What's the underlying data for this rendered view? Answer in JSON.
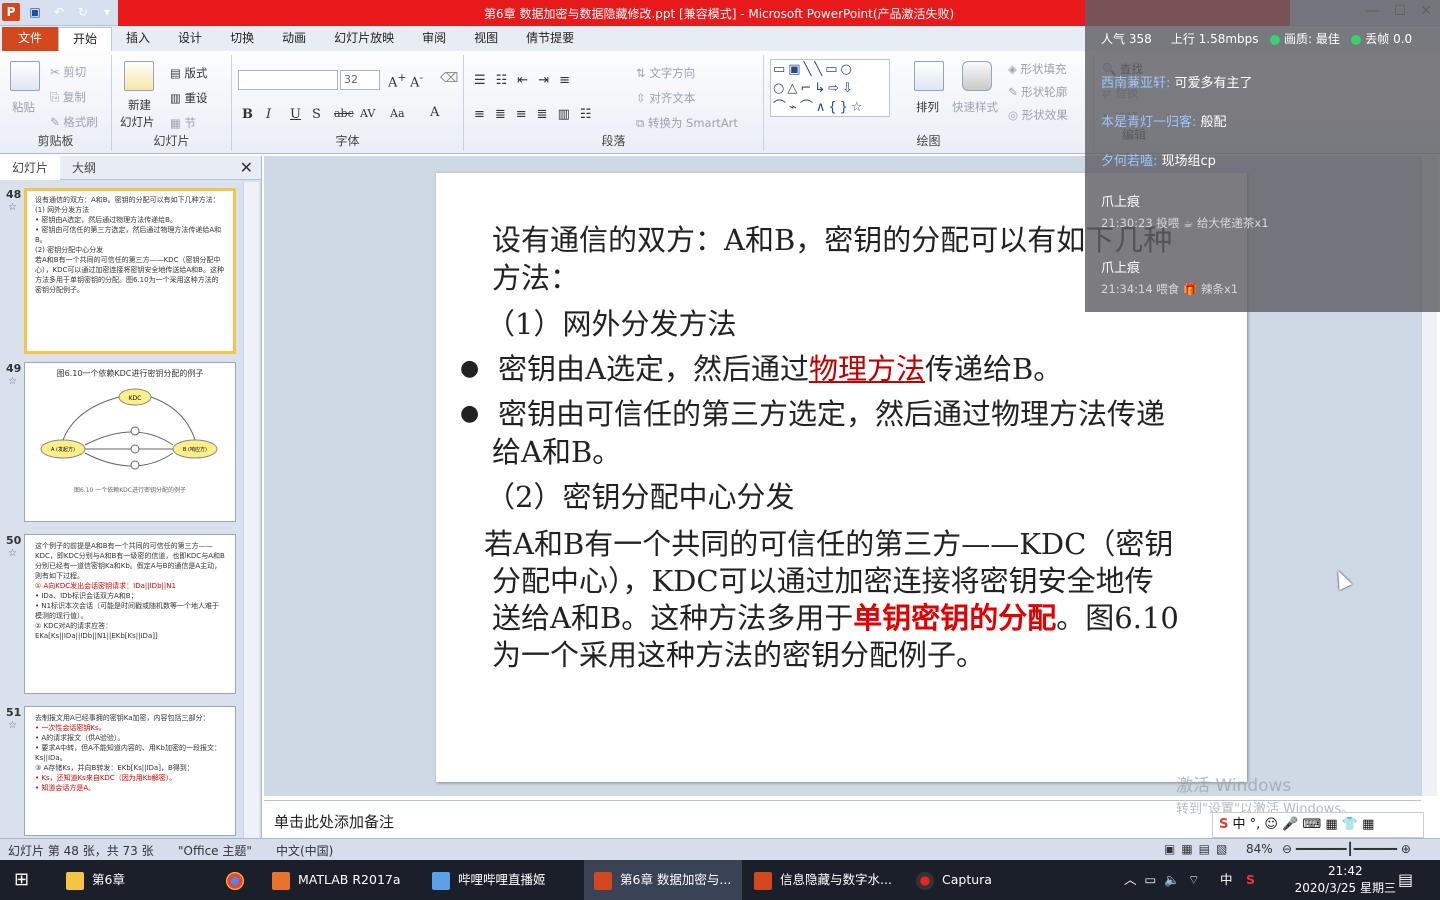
{
  "window": {
    "title": "第6章 数据加密与数据隐藏修改.ppt [兼容模式] - Microsoft PowerPoint(产品激活失败)",
    "app_icon": "P"
  },
  "ribbon_tabs": [
    "文件",
    "开始",
    "插入",
    "设计",
    "切换",
    "动画",
    "幻灯片放映",
    "审阅",
    "视图",
    "倩节提要"
  ],
  "ribbon": {
    "clipboard": {
      "paste": "粘贴",
      "cut": "剪切",
      "copy": "复制",
      "format_painter": "格式刷",
      "label": "剪贴板"
    },
    "slides": {
      "new_slide": "新建",
      "new_slide2": "幻灯片",
      "layout": "版式",
      "reset": "重设",
      "section": "节",
      "label": "幻灯片"
    },
    "font": {
      "size": "32",
      "label": "字体"
    },
    "paragraph": {
      "text_direction": "文字方向",
      "align_text": "对齐文本",
      "smartart": "转换为 SmartArt",
      "label": "段落"
    },
    "drawing": {
      "arrange": "排列",
      "quick_styles": "快速样式",
      "shape_fill": "形状填充",
      "shape_outline": "形状轮廓",
      "shape_effects": "形状效果",
      "label": "绘图"
    },
    "editing": {
      "find": "查找",
      "replace": "替换",
      "select": "选择",
      "label": "编辑"
    }
  },
  "left_panel": {
    "tabs": [
      "幻灯片",
      "大纲"
    ],
    "thumbnails": [
      {
        "num": "48",
        "lines": [
          "设有通信的双方：A和B。密钥的分配可以有如下几种方法：",
          "(1) 网外分发方法",
          "• 密钥由A选定，然后通过物理方法传递给B。",
          "• 密钥由可信任的第三方选定，然后通过物理方法传递给A和B。",
          "(2) 密钥分配中心分发",
          "若A和B有一个共同的可信任的第三方——KDC（密钥分配中心），KDC可以通过加密连接将密钥安全地传送给A和B。这种方法多用于单钥密钥的分配。图6.10为一个采用这种方法的密钥分配例子。"
        ]
      },
      {
        "num": "49",
        "lines": [
          "图6.10一个依赖KDC进行密钥分配的例子",
          "KDC",
          "A (发起方)",
          "B (响应方)",
          "图6.10 一个依赖KDC进行密钥分配的例子"
        ]
      },
      {
        "num": "50",
        "lines": [
          "这个例子的前提是A和B有一个共同的可信任的第三方——KDC，即KDC分别与A和B有一级密的信道，也即KDC与A和B分别已经有一道信密钥Ka和Kb。假定A与B的通信是A主动，则有如下过程。",
          "① A向KDC发出会话密钥请求：IDa||IDb||N1",
          "• IDa、IDb标识会话双方A和B；",
          "• N1标识本次会话（可能是时间戳或随机数等一个地人难于模测的现行值）。",
          "② KDC对A的请求应答：",
          "EKa[Ks||IDa||IDb||N1||EKb[Ks||IDa]]"
        ]
      },
      {
        "num": "51",
        "lines": [
          "去制报文用A已经事拥的密钥Ka加密，内容包括三部分：",
          "• 一次性会话密钥Ks。",
          "• A的请求报文（供A验验）。",
          "• 要求A中转，但A不能知道内容的、用Kb加密的一段报文：Ks||IDa。",
          "③ A存储Ks，并向B转发：EKb[Ks||IDa]，B得到：",
          "• Ks，还知道Ks来自KDC（因为用Kb解密）。",
          "• 知道会话方是A。"
        ]
      }
    ]
  },
  "slide": {
    "line1": "设有通信的双方：A和B，密钥的分配可以有如下几种",
    "line2": "方法：",
    "line3": "（1）网外分发方法",
    "line4_a": "密钥由A选定，然后通过",
    "line4_link": "物理方法",
    "line4_b": "传递给B。",
    "line5": "密钥由可信任的第三方选定，然后通过物理方法传递",
    "line6": "给A和B。",
    "line7": "（2）密钥分配中心分发",
    "line8": "若A和B有一个共同的可信任的第三方——KDC（密钥",
    "line9": "分配中心），KDC可以通过加密连接将密钥安全地传",
    "line10_a": "送给A和B。这种方法多用于",
    "line10_red": "单钥密钥的分配",
    "line10_b": "。图6.10",
    "line11": "为一个采用这种方法的密钥分配例子。"
  },
  "notes_placeholder": "单击此处添加备注",
  "status": {
    "slide_info": "幻灯片 第 48 张，共 73 张",
    "theme": "\"Office 主题\"",
    "language": "中文(中国)",
    "zoom": "84%"
  },
  "overlay": {
    "popularity": "人气 358",
    "upload": "上行 1.58mbps",
    "quality": "画质: 最佳",
    "drop": "丢帧 0.0",
    "messages": [
      {
        "user": "西南蒹亚轩:",
        "text": "可爱多有主了"
      },
      {
        "user": "本是青灯一归客:",
        "text": "般配"
      },
      {
        "user": "夕何若嗑:",
        "text": "现场组cp"
      }
    ],
    "gifts": [
      {
        "name": "爪上痕",
        "time": "21:30:23 投喂",
        "gift": "给大佬递茶x1"
      },
      {
        "name": "爪上痕",
        "time": "21:34:14 喂食",
        "gift": "辣条x1"
      }
    ]
  },
  "watermark": {
    "line1": "激活 Windows",
    "line2": "转到\"设置\"以激活 Windows。"
  },
  "ime": {
    "lang": "中"
  },
  "taskbar": {
    "items": [
      "第6章",
      "MATLAB R2017a",
      "哔哩哔哩直播姬",
      "第6章 数据加密与...",
      "信息隐藏与数字水...",
      "Captura"
    ],
    "tray_lang": "中",
    "time": "21:42",
    "date": "2020/3/25 星期三"
  }
}
